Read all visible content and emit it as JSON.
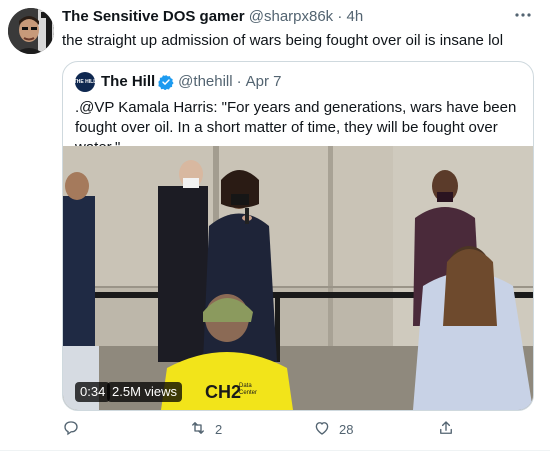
{
  "tweet": {
    "author_name": "The Sensitive DOS gamer",
    "handle": "@sharpx86k",
    "separator": "·",
    "time": "4h",
    "text": "the straight up admission of wars being fought over oil is insane lol",
    "avatar_icon": "user-avatar"
  },
  "quoted_tweet": {
    "avatar_text": "THE HILL",
    "author_name": "The Hill",
    "verified": true,
    "handle": "@thehill",
    "separator": "·",
    "date": "Apr 7",
    "text": ".@VP Kamala Harris: \"For years and generations, wars have been fought over oil. In a short matter of time, they will be fought over water.\"",
    "video": {
      "duration": "0:34",
      "views": "2.5M views",
      "shirt_text": "CH2",
      "shirt_small_text": "Data Center"
    }
  },
  "actions": {
    "reply_count": "",
    "retweet_count": "2",
    "like_count": "28",
    "icons": [
      "reply-icon",
      "retweet-icon",
      "like-icon",
      "share-icon"
    ]
  },
  "colors": {
    "text": "#0f1419",
    "muted": "#536471",
    "border": "#cfd9de",
    "verified": "#1d9bf0"
  }
}
